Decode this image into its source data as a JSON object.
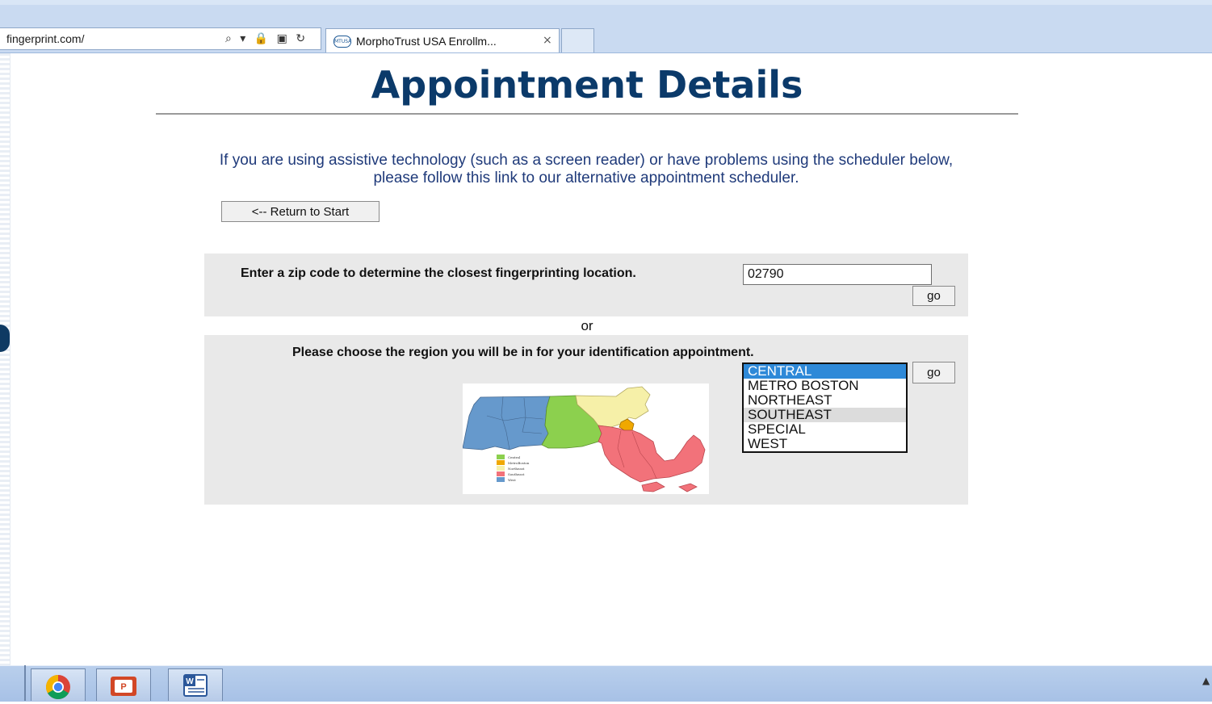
{
  "browser": {
    "address_text": "fingerprint.com/",
    "address_icons": "⌕ ▾ 🔒 ▣ ↻",
    "tab_favicon_text": "MTUSA",
    "tab_title": "MorphoTrust USA Enrollm...",
    "tab_close": "×"
  },
  "page": {
    "title": "Appointment Details",
    "notice_line1": "If you are using assistive technology (such as a screen reader) or have problems using the scheduler below,",
    "notice_line2": "please follow this link to our alternative appointment scheduler.",
    "return_button": "<-- Return to Start",
    "zip": {
      "label": "Enter a zip code to determine the closest fingerprinting location.",
      "value": "02790",
      "go_label": "go"
    },
    "or_label": "or",
    "region": {
      "label": "Please choose the region you will be in for your identification appointment.",
      "options": [
        "CENTRAL",
        "METRO BOSTON",
        "NORTHEAST",
        "SOUTHEAST",
        "SPECIAL",
        "WEST"
      ],
      "selected": "CENTRAL",
      "highlighted": "SOUTHEAST",
      "go_label": "go"
    },
    "map_legend": {
      "items": [
        "Central",
        "MetroBoston",
        "Northeast",
        "Southeast",
        "West"
      ],
      "colors": {
        "Central": "#8cd04e",
        "MetroBoston": "#f0a800",
        "Northeast": "#f6f0a8",
        "Southeast": "#f2727a",
        "West": "#6699cc"
      }
    }
  },
  "taskbar": {
    "apps": [
      "chrome-icon",
      "powerpoint-icon",
      "word-icon"
    ],
    "tray_arrow": "▲"
  }
}
